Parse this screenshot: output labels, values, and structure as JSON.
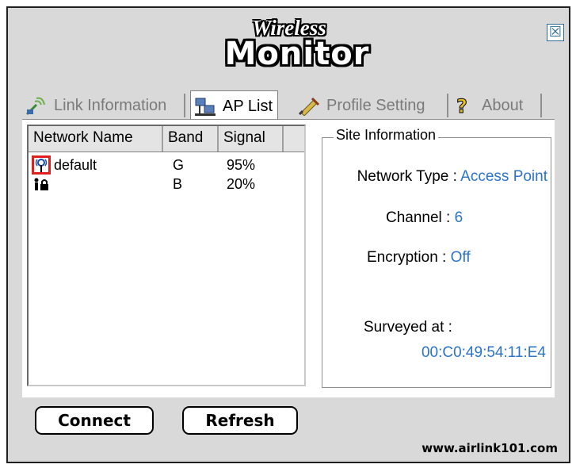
{
  "logo": {
    "top": "Wireless",
    "bottom": "Monitor"
  },
  "window": {
    "close_symbol": "☒"
  },
  "tabs": [
    {
      "label": "Link Information",
      "icon": "link-info-icon",
      "active": false
    },
    {
      "label": "AP List",
      "icon": "ap-list-icon",
      "active": true
    },
    {
      "label": "Profile Setting",
      "icon": "profile-setting-icon",
      "active": false
    },
    {
      "label": "About",
      "icon": "about-icon",
      "active": false
    }
  ],
  "ap_list": {
    "columns": [
      "Network Name",
      "Band",
      "Signal"
    ],
    "rows": [
      {
        "name": "default",
        "band": "G",
        "signal": "95%",
        "icon": "access-point-icon"
      },
      {
        "name": "",
        "band": "B",
        "signal": "20%",
        "icon": "locked-adhoc-icon"
      }
    ]
  },
  "site_info": {
    "legend": "Site Information",
    "network_type_label": "Network Type :",
    "network_type_value": "Access Point",
    "channel_label": "Channel :",
    "channel_value": "6",
    "encryption_label": "Encryption :",
    "encryption_value": "Off",
    "surveyed_label": "Surveyed at :",
    "surveyed_value": "00:C0:49:54:11:E4"
  },
  "buttons": {
    "connect": "Connect",
    "refresh": "Refresh"
  },
  "footer": {
    "url": "www.airlink101.com"
  },
  "colors": {
    "value_blue": "#2a73c8",
    "highlight_red": "#e0201c"
  }
}
